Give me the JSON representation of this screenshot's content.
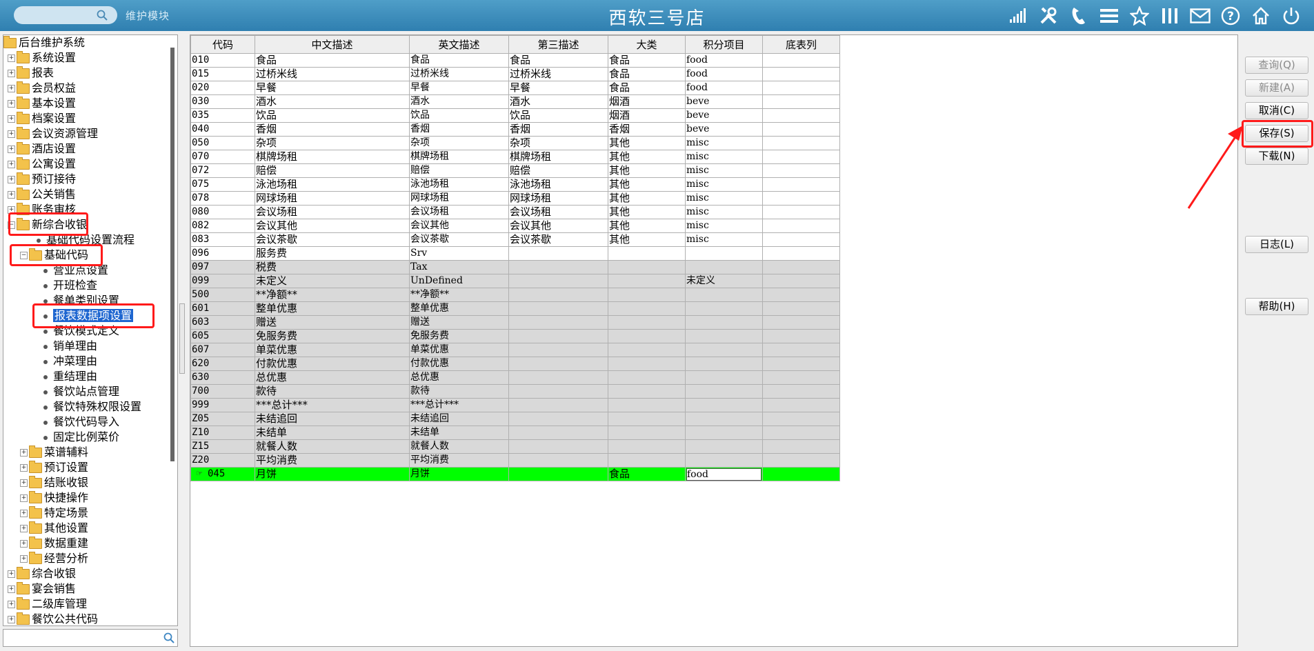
{
  "header": {
    "title": "西软三号店",
    "module_label": "维护模块",
    "icons": [
      "signal-icon",
      "tools-icon",
      "phone-icon",
      "menu-icon",
      "star-icon",
      "columns-icon",
      "mail-icon",
      "help-icon",
      "home-icon",
      "power-icon"
    ]
  },
  "tree": {
    "items": [
      {
        "label": "后台维护系统",
        "level": 0,
        "type": "root"
      },
      {
        "label": "系统设置",
        "level": 1,
        "type": "folder",
        "pm": "+"
      },
      {
        "label": "报表",
        "level": 1,
        "type": "folder",
        "pm": "+"
      },
      {
        "label": "会员权益",
        "level": 1,
        "type": "folder",
        "pm": "+"
      },
      {
        "label": "基本设置",
        "level": 1,
        "type": "folder",
        "pm": "+"
      },
      {
        "label": "档案设置",
        "level": 1,
        "type": "folder",
        "pm": "+"
      },
      {
        "label": "会议资源管理",
        "level": 1,
        "type": "folder",
        "pm": "+"
      },
      {
        "label": "酒店设置",
        "level": 1,
        "type": "folder",
        "pm": "+"
      },
      {
        "label": "公寓设置",
        "level": 1,
        "type": "folder",
        "pm": "+"
      },
      {
        "label": "预订接待",
        "level": 1,
        "type": "folder",
        "pm": "+"
      },
      {
        "label": "公关销售",
        "level": 1,
        "type": "folder",
        "pm": "+"
      },
      {
        "label": "账务审核",
        "level": 1,
        "type": "folder",
        "pm": "+"
      },
      {
        "label": "新综合收银",
        "level": 1,
        "type": "folder",
        "pm": "-"
      },
      {
        "label": "基础代码设置流程",
        "level": 2,
        "type": "leaf"
      },
      {
        "label": "基础代码",
        "level": 2,
        "type": "folder",
        "pm": "-"
      },
      {
        "label": "营业点设置",
        "level": 3,
        "type": "leaf"
      },
      {
        "label": "开班检查",
        "level": 3,
        "type": "leaf"
      },
      {
        "label": "餐单类别设置",
        "level": 3,
        "type": "leaf"
      },
      {
        "label": "报表数据项设置",
        "level": 3,
        "type": "leaf",
        "selected": true
      },
      {
        "label": "餐饮模式定义",
        "level": 3,
        "type": "leaf"
      },
      {
        "label": "销单理由",
        "level": 3,
        "type": "leaf"
      },
      {
        "label": "冲菜理由",
        "level": 3,
        "type": "leaf"
      },
      {
        "label": "重结理由",
        "level": 3,
        "type": "leaf"
      },
      {
        "label": "餐饮站点管理",
        "level": 3,
        "type": "leaf"
      },
      {
        "label": "餐饮特殊权限设置",
        "level": 3,
        "type": "leaf"
      },
      {
        "label": "餐饮代码导入",
        "level": 3,
        "type": "leaf"
      },
      {
        "label": "固定比例菜价",
        "level": 3,
        "type": "leaf"
      },
      {
        "label": "菜谱辅料",
        "level": 2,
        "type": "folder",
        "pm": "+"
      },
      {
        "label": "预订设置",
        "level": 2,
        "type": "folder",
        "pm": "+"
      },
      {
        "label": "结账收银",
        "level": 2,
        "type": "folder",
        "pm": "+"
      },
      {
        "label": "快捷操作",
        "level": 2,
        "type": "folder",
        "pm": "+"
      },
      {
        "label": "特定场景",
        "level": 2,
        "type": "folder",
        "pm": "+"
      },
      {
        "label": "其他设置",
        "level": 2,
        "type": "folder",
        "pm": "+"
      },
      {
        "label": "数据重建",
        "level": 2,
        "type": "folder",
        "pm": "+"
      },
      {
        "label": "经营分析",
        "level": 2,
        "type": "folder",
        "pm": "+"
      },
      {
        "label": "综合收银",
        "level": 1,
        "type": "folder",
        "pm": "+"
      },
      {
        "label": "宴会销售",
        "level": 1,
        "type": "folder",
        "pm": "+"
      },
      {
        "label": "二级库管理",
        "level": 1,
        "type": "folder",
        "pm": "+"
      },
      {
        "label": "餐饮公共代码",
        "level": 1,
        "type": "folder",
        "pm": "+"
      }
    ]
  },
  "grid": {
    "columns": [
      "代码",
      "中文描述",
      "英文描述",
      "第三描述",
      "大类",
      "积分项目",
      "底表列"
    ],
    "rows": [
      {
        "code": "010",
        "zh": "食品",
        "en": "食品",
        "third": "食品",
        "cat": "食品",
        "pts": "food",
        "base": "",
        "style": "white"
      },
      {
        "code": "015",
        "zh": "过桥米线",
        "en": "过桥米线",
        "third": "过桥米线",
        "cat": "食品",
        "pts": "food",
        "base": "",
        "style": "white"
      },
      {
        "code": "020",
        "zh": "早餐",
        "en": "早餐",
        "third": "早餐",
        "cat": "食品",
        "pts": "food",
        "base": "",
        "style": "white"
      },
      {
        "code": "030",
        "zh": "酒水",
        "en": "酒水",
        "third": "酒水",
        "cat": "烟酒",
        "pts": "beve",
        "base": "",
        "style": "white"
      },
      {
        "code": "035",
        "zh": "饮品",
        "en": "饮品",
        "third": "饮品",
        "cat": "烟酒",
        "pts": "beve",
        "base": "",
        "style": "white"
      },
      {
        "code": "040",
        "zh": "香烟",
        "en": "香烟",
        "third": "香烟",
        "cat": "香烟",
        "pts": "beve",
        "base": "",
        "style": "white"
      },
      {
        "code": "050",
        "zh": "杂项",
        "en": "杂项",
        "third": "杂项",
        "cat": "其他",
        "pts": "misc",
        "base": "",
        "style": "white"
      },
      {
        "code": "070",
        "zh": "棋牌场租",
        "en": "棋牌场租",
        "third": "棋牌场租",
        "cat": "其他",
        "pts": "misc",
        "base": "",
        "style": "white"
      },
      {
        "code": "072",
        "zh": "赔偿",
        "en": "赔偿",
        "third": "赔偿",
        "cat": "其他",
        "pts": "misc",
        "base": "",
        "style": "white"
      },
      {
        "code": "075",
        "zh": "泳池场租",
        "en": "泳池场租",
        "third": "泳池场租",
        "cat": "其他",
        "pts": "misc",
        "base": "",
        "style": "white"
      },
      {
        "code": "078",
        "zh": "网球场租",
        "en": "网球场租",
        "third": "网球场租",
        "cat": "其他",
        "pts": "misc",
        "base": "",
        "style": "white"
      },
      {
        "code": "080",
        "zh": "会议场租",
        "en": "会议场租",
        "third": "会议场租",
        "cat": "其他",
        "pts": "misc",
        "base": "",
        "style": "white"
      },
      {
        "code": "082",
        "zh": "会议其他",
        "en": "会议其他",
        "third": "会议其他",
        "cat": "其他",
        "pts": "misc",
        "base": "",
        "style": "white"
      },
      {
        "code": "083",
        "zh": "会议茶歇",
        "en": "会议茶歇",
        "third": "会议茶歇",
        "cat": "其他",
        "pts": "misc",
        "base": "",
        "style": "white"
      },
      {
        "code": "096",
        "zh": "服务费",
        "en": "Srv",
        "third": "",
        "cat": "",
        "pts": "",
        "base": "",
        "style": "white"
      },
      {
        "code": "097",
        "zh": "税费",
        "en": "Tax",
        "third": "",
        "cat": "",
        "pts": "",
        "base": "",
        "style": "gray"
      },
      {
        "code": "099",
        "zh": "未定义",
        "en": "UnDefined",
        "third": "",
        "cat": "",
        "pts": "未定义",
        "base": "",
        "style": "gray"
      },
      {
        "code": "500",
        "zh": "**净额**",
        "en": "**净额**",
        "third": "",
        "cat": "",
        "pts": "",
        "base": "",
        "style": "gray"
      },
      {
        "code": "601",
        "zh": "整单优惠",
        "en": "整单优惠",
        "third": "",
        "cat": "",
        "pts": "",
        "base": "",
        "style": "gray"
      },
      {
        "code": "603",
        "zh": "赠送",
        "en": "赠送",
        "third": "",
        "cat": "",
        "pts": "",
        "base": "",
        "style": "gray"
      },
      {
        "code": "605",
        "zh": "免服务费",
        "en": "免服务费",
        "third": "",
        "cat": "",
        "pts": "",
        "base": "",
        "style": "gray"
      },
      {
        "code": "607",
        "zh": "单菜优惠",
        "en": "单菜优惠",
        "third": "",
        "cat": "",
        "pts": "",
        "base": "",
        "style": "gray"
      },
      {
        "code": "620",
        "zh": "付款优惠",
        "en": "付款优惠",
        "third": "",
        "cat": "",
        "pts": "",
        "base": "",
        "style": "gray"
      },
      {
        "code": "630",
        "zh": "总优惠",
        "en": "总优惠",
        "third": "",
        "cat": "",
        "pts": "",
        "base": "",
        "style": "gray"
      },
      {
        "code": "700",
        "zh": "款待",
        "en": "款待",
        "third": "",
        "cat": "",
        "pts": "",
        "base": "",
        "style": "gray"
      },
      {
        "code": "999",
        "zh": "***总计***",
        "en": "***总计***",
        "third": "",
        "cat": "",
        "pts": "",
        "base": "",
        "style": "gray"
      },
      {
        "code": "Z05",
        "zh": "未结追回",
        "en": "未结追回",
        "third": "",
        "cat": "",
        "pts": "",
        "base": "",
        "style": "gray"
      },
      {
        "code": "Z10",
        "zh": "未结单",
        "en": "未结单",
        "third": "",
        "cat": "",
        "pts": "",
        "base": "",
        "style": "gray"
      },
      {
        "code": "Z15",
        "zh": "就餐人数",
        "en": "就餐人数",
        "third": "",
        "cat": "",
        "pts": "",
        "base": "",
        "style": "gray"
      },
      {
        "code": "Z20",
        "zh": "平均消费",
        "en": "平均消费",
        "third": "",
        "cat": "",
        "pts": "",
        "base": "",
        "style": "gray"
      },
      {
        "code": "045",
        "zh": "月饼",
        "en": "月饼",
        "third": "",
        "cat": "食品",
        "pts": "food",
        "base": "",
        "style": "highlight",
        "editing": "pts"
      }
    ]
  },
  "buttons": {
    "query": "查询(Q)",
    "new": "新建(A)",
    "cancel": "取消(C)",
    "save": "保存(S)",
    "download": "下载(N)",
    "log": "日志(L)",
    "help": "帮助(H)"
  },
  "colors": {
    "header_bg": "#3a8cbf",
    "selection": "#1e66d0",
    "row_highlight": "#00ff00",
    "row_gray": "#d9d9d9",
    "annotation": "#ff1a1a"
  }
}
